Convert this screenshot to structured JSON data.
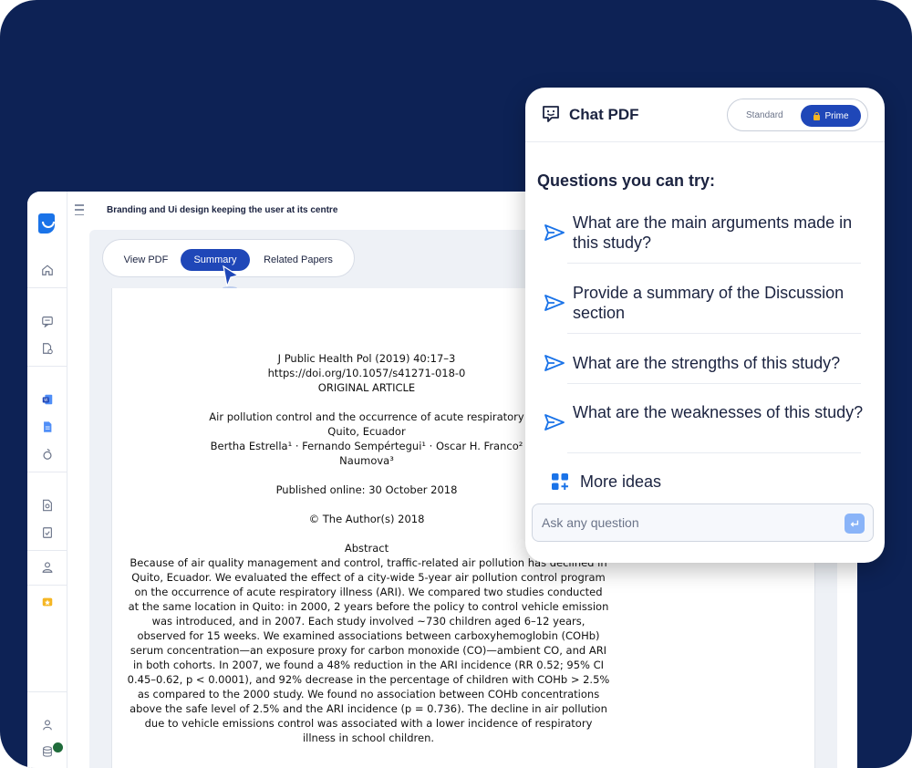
{
  "app": {
    "document_title": "Branding and Ui design keeping the user at its centre",
    "tabs": [
      {
        "label": "View PDF",
        "active": false
      },
      {
        "label": "Summary",
        "active": true
      },
      {
        "label": "Related Papers",
        "active": false
      }
    ],
    "sidebar_icons": [
      "app-logo-icon",
      "home-icon",
      "chat-icon",
      "file-settings-icon",
      "word-doc-icon",
      "google-doc-icon",
      "rewrite-icon",
      "file-search-icon",
      "file-check-icon",
      "user-group-icon",
      "premium-icon",
      "profile-icon",
      "database-icon"
    ],
    "status_color": "#1f6b3a"
  },
  "paper": {
    "journal": "J Public Health Pol (2019) 40:17–3",
    "doi": "https://doi.org/10.1057/s41271-018-0",
    "article_type": "ORIGINAL ARTICLE",
    "title_line1": "Air pollution control and the occurrence of acute respiratory",
    "title_line2": "Quito, Ecuador",
    "authors_line1": "Bertha Estrella¹ · Fernando Sempértegui¹ · Oscar H. Franco²",
    "authors_line2": "Naumova³",
    "published": "Published online: 30 October 2018",
    "copyright": "© The Author(s) 2018",
    "abstract_heading": "Abstract",
    "abstract_lines": [
      "Because of air quality management and control, traffic-related air pollution has declined in",
      "Quito, Ecuador. We evaluated the effect of a city-wide 5-year air pollution control program",
      "on the occurrence of acute respiratory illness (ARI). We compared two studies conducted",
      "at the same location in Quito: in 2000, 2 years before the policy to control vehicle emission",
      "was introduced, and in 2007. Each study involved ~730 children aged 6–12 years,",
      "observed for 15 weeks. We examined associations between carboxyhemoglobin (COHb)",
      "serum concentration—an exposure proxy for carbon monoxide (CO)—ambient CO, and ARI",
      "in both cohorts. In 2007, we found a 48% reduction in the ARI incidence (RR 0.52; 95% CI",
      "0.45–0.62, p < 0.0001), and 92% decrease in the percentage of children with COHb > 2.5%",
      "as compared to the 2000 study. We found no association between COHb concentrations",
      "above the safe level of 2.5% and the ARI incidence (p = 0.736). The decline in air pollution",
      "due to vehicle emissions control was associated with a lower incidence of respiratory",
      "illness in school children."
    ]
  },
  "chat": {
    "title": "Chat PDF",
    "mode_standard": "Standard",
    "mode_prime": "Prime",
    "questions_heading": "Questions you can try:",
    "questions": [
      "What are the main arguments made in this study?",
      "Provide a summary of the Discussion section",
      "What are the strengths of this study?",
      "What are the weaknesses of this study?"
    ],
    "more_label": "More ideas",
    "input_placeholder": "Ask any question",
    "accent_color": "#1f47b8",
    "send_icon_color": "#1a73e8"
  }
}
